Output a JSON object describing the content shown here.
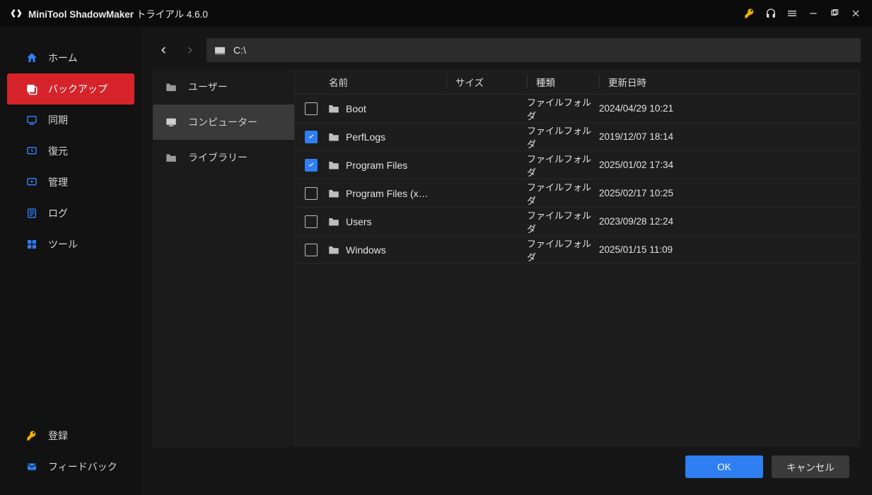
{
  "title": {
    "app": "MiniTool ShadowMaker",
    "edition": "トライアル 4.6.0"
  },
  "sidebar": {
    "items": [
      {
        "label": "ホーム"
      },
      {
        "label": "バックアップ"
      },
      {
        "label": "同期"
      },
      {
        "label": "復元"
      },
      {
        "label": "管理"
      },
      {
        "label": "ログ"
      },
      {
        "label": "ツール"
      }
    ],
    "bottom": [
      {
        "label": "登録"
      },
      {
        "label": "フィードバック"
      }
    ]
  },
  "path": {
    "text": "C:\\"
  },
  "leftpane": {
    "items": [
      {
        "label": "ユーザー"
      },
      {
        "label": "コンピューター"
      },
      {
        "label": "ライブラリー"
      }
    ]
  },
  "columns": {
    "name": "名前",
    "size": "サイズ",
    "kind": "種類",
    "date": "更新日時"
  },
  "rows": [
    {
      "checked": false,
      "name": "Boot",
      "kind": "ファイルフォルダ",
      "date": "2024/04/29 10:21"
    },
    {
      "checked": true,
      "name": "PerfLogs",
      "kind": "ファイルフォルダ",
      "date": "2019/12/07 18:14"
    },
    {
      "checked": true,
      "name": "Program Files",
      "kind": "ファイルフォルダ",
      "date": "2025/01/02 17:34"
    },
    {
      "checked": false,
      "name": "Program Files (x…",
      "kind": "ファイルフォルダ",
      "date": "2025/02/17 10:25"
    },
    {
      "checked": false,
      "name": "Users",
      "kind": "ファイルフォルダ",
      "date": "2023/09/28 12:24"
    },
    {
      "checked": false,
      "name": "Windows",
      "kind": "ファイルフォルダ",
      "date": "2025/01/15 11:09"
    }
  ],
  "footer": {
    "ok": "OK",
    "cancel": "キャンセル"
  }
}
